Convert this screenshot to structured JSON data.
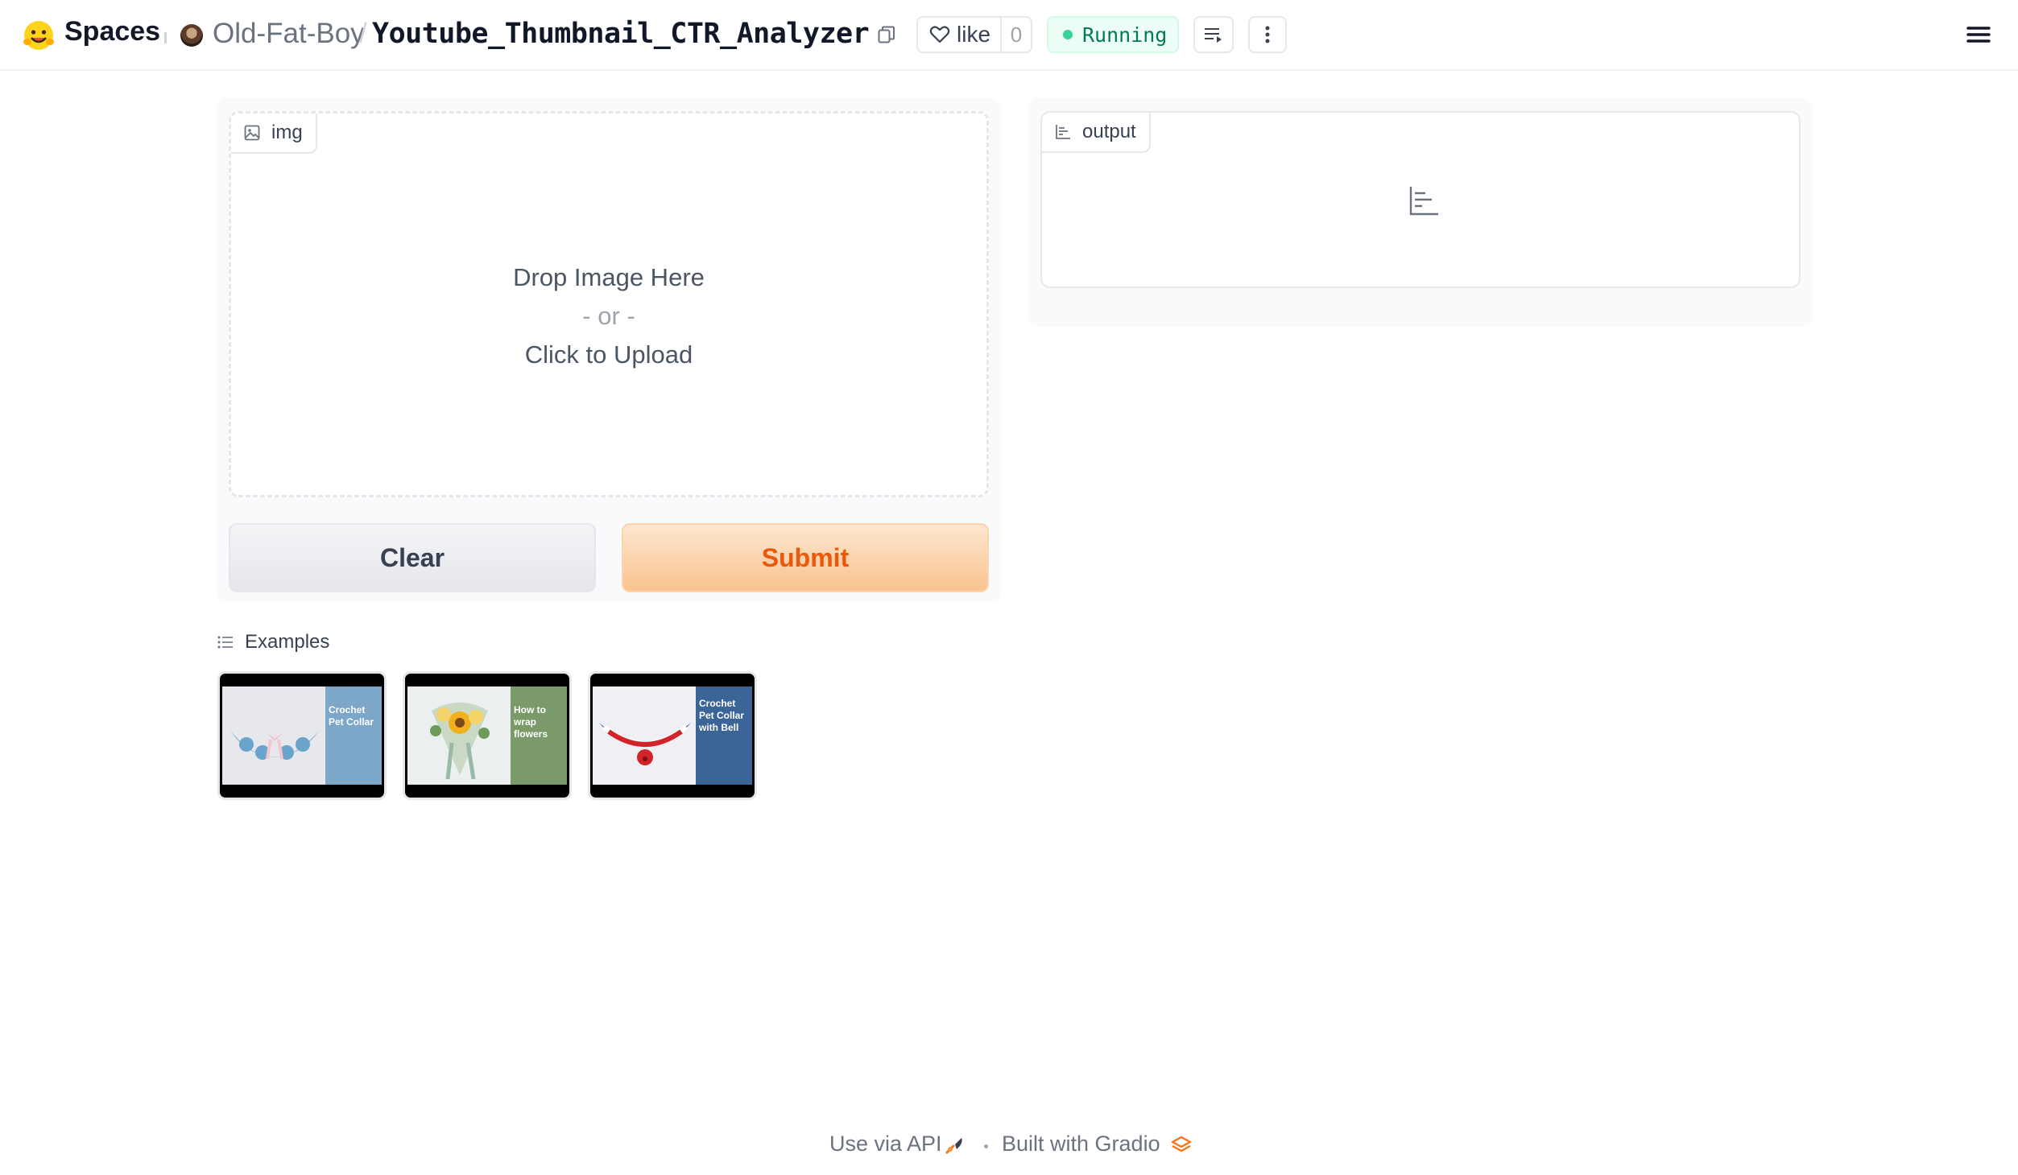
{
  "header": {
    "brand": "Spaces",
    "owner": "Old-Fat-Boy",
    "separator": "/",
    "repo": "Youtube_Thumbnail_CTR_Analyzer",
    "like_label": "like",
    "like_count": "0",
    "status": "Running",
    "status_color": "#34d399"
  },
  "input": {
    "label": "img",
    "drop_text": "Drop Image Here",
    "or_text": "- or -",
    "upload_text": "Click to Upload"
  },
  "buttons": {
    "clear": "Clear",
    "submit": "Submit",
    "submit_color": "#ea580c"
  },
  "output": {
    "label": "output"
  },
  "examples": {
    "label": "Examples",
    "items": [
      {
        "caption": "Crochet Pet Collar",
        "panel_color": "#7da7c9"
      },
      {
        "caption": "How to wrap flowers",
        "panel_color": "#7a9a6a"
      },
      {
        "caption": "Crochet Pet Collar with Bell",
        "panel_color": "#3c6597"
      }
    ]
  },
  "footer": {
    "api": "Use via API",
    "built_with": "Built with Gradio"
  }
}
